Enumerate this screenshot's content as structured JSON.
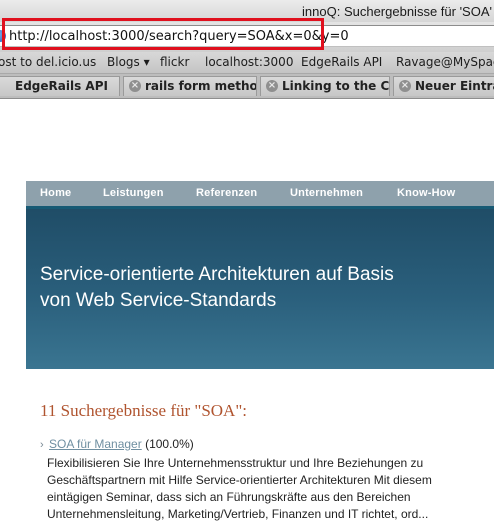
{
  "window": {
    "title": "innoQ: Suchergebnisse für 'SOA'"
  },
  "urlbar": {
    "url": "http://localhost:3000/search?query=SOA&x=0&y=0"
  },
  "bookmarks": [
    {
      "label": "ost to del.icio.us"
    },
    {
      "label": "Blogs ▾"
    },
    {
      "label": "flickr"
    },
    {
      "label": "localhost:3000"
    },
    {
      "label": "EdgeRails API"
    },
    {
      "label": "Ravage@MySpace"
    }
  ],
  "tabs": [
    {
      "label": "EdgeRails API",
      "close": ""
    },
    {
      "label": "rails form metho...",
      "close": "×"
    },
    {
      "label": "Linking to the C...",
      "close": "×"
    },
    {
      "label": "Neuer Eintrag",
      "close": "×"
    }
  ],
  "site_nav": [
    {
      "label": "Home"
    },
    {
      "label": "Leistungen"
    },
    {
      "label": "Referenzen"
    },
    {
      "label": "Unternehmen"
    },
    {
      "label": "Know-How"
    }
  ],
  "banner": {
    "line1": "Service-orientierte Architekturen auf Basis",
    "line2": "von Web Service-Standards"
  },
  "results": {
    "title": "11 Suchergebnisse für \"SOA\":",
    "items": [
      {
        "arrow": "›",
        "link": "SOA für Manager",
        "score": "(100.0%)",
        "desc": [
          "Flexibilisieren Sie Ihre Unternehmensstruktur und Ihre Beziehungen zu",
          "Geschäftspartnern mit Hilfe Service-orientierter Architekturen Mit diesem",
          "eintägigen Seminar, dass sich an Führungskräfte aus den Bereichen",
          "Unternehmensleitung, Marketing/Vertrieb, Finanzen und IT richtet, ord..."
        ]
      }
    ]
  },
  "colors": {
    "url_highlight": "#e0101e",
    "nav_bg": "#8ea1ac",
    "banner_bg": "#2a5f7c",
    "results_title": "#b0542f",
    "result_link": "#6f8fa1"
  }
}
